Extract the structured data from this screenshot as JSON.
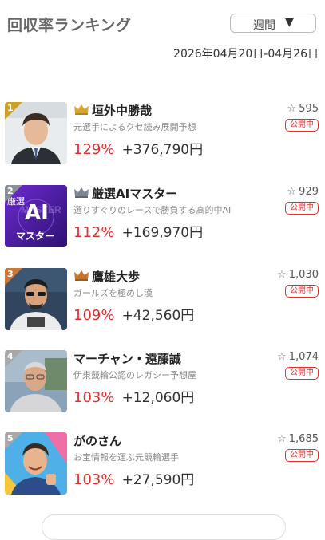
{
  "header": {
    "title": "回収率ランキング",
    "period_selected": "週間",
    "date_range": "2026年04月20日-04月26日"
  },
  "colors": {
    "accent_red": "#e0312f",
    "rank1": "#c9a227",
    "rank2": "#8a8f98",
    "rank3": "#c8783a",
    "rank4": "#a8a8a8",
    "rank5": "#a8a8a8"
  },
  "rankings": [
    {
      "rank": "1",
      "name": "垣外中勝哉",
      "description": "元選手によるクセ読み展開予想",
      "rate": "129%",
      "profit": "+376,790円",
      "favorites": "595",
      "status": "公開中",
      "crown": "gold-crown-icon"
    },
    {
      "rank": "2",
      "name": "厳選AIマスター",
      "description": "選りすぐりのレースで勝負する高的中AI",
      "rate": "112%",
      "profit": "+169,970円",
      "favorites": "929",
      "status": "公開中",
      "crown": "silver-crown-icon",
      "thumb_text": "厳選",
      "thumb_ai": "AI",
      "thumb_sub": "マスター"
    },
    {
      "rank": "3",
      "name": "鷹雄大歩",
      "description": "ガールズを極めし漢",
      "rate": "109%",
      "profit": "+42,560円",
      "favorites": "1,030",
      "status": "公開中",
      "crown": "bronze-crown-icon"
    },
    {
      "rank": "4",
      "name": "マーチャン・遠藤誠",
      "description": "伊東競輪公認のレガシー予想屋",
      "rate": "103%",
      "profit": "+12,060円",
      "favorites": "1,074",
      "status": "公開中"
    },
    {
      "rank": "5",
      "name": "がのさん",
      "description": "お宝情報を運ぶ元競輪選手",
      "rate": "103%",
      "profit": "+27,590円",
      "favorites": "1,685",
      "status": "公開中"
    }
  ]
}
